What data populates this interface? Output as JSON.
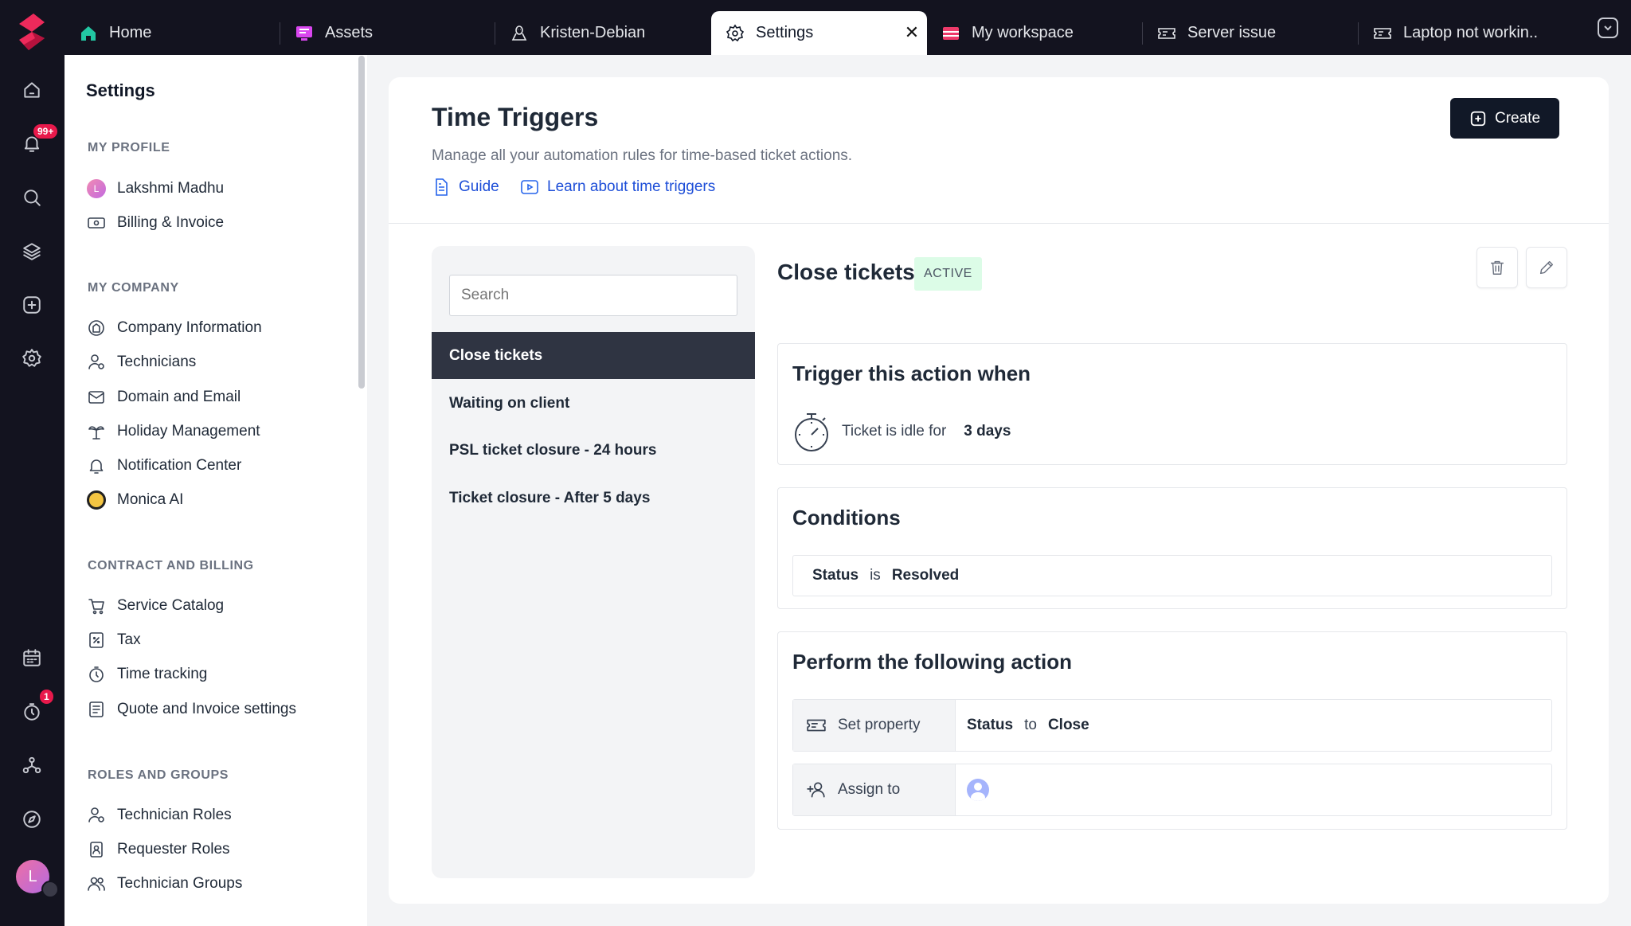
{
  "rail": {
    "notifications_badge": "99+",
    "timer_badge": "1",
    "avatar_initial": "L"
  },
  "tabs": [
    {
      "label": "Home",
      "icon": "home-icon"
    },
    {
      "label": "Assets",
      "icon": "monitor-icon"
    },
    {
      "label": "Kristen-Debian",
      "icon": "linux-icon"
    },
    {
      "label": "Settings",
      "icon": "gear-icon",
      "active": true
    },
    {
      "label": "My workspace",
      "icon": "workspace-icon"
    },
    {
      "label": "Server issue",
      "icon": "ticket-icon"
    },
    {
      "label": "Laptop not workin..",
      "icon": "ticket-icon"
    }
  ],
  "sidebar": {
    "title": "Settings",
    "sections": {
      "my_profile": "MY PROFILE",
      "my_company": "MY COMPANY",
      "contract": "CONTRACT AND BILLING",
      "roles": "ROLES AND GROUPS"
    },
    "items": {
      "profile_name": "Lakshmi Madhu",
      "profile_initial": "L",
      "billing": "Billing & Invoice",
      "company_info": "Company Information",
      "technicians": "Technicians",
      "domain_email": "Domain and Email",
      "holiday": "Holiday Management",
      "notification": "Notification Center",
      "monica": "Monica AI",
      "service_catalog": "Service Catalog",
      "tax": "Tax",
      "time_tracking": "Time tracking",
      "quote_invoice": "Quote and Invoice settings",
      "tech_roles": "Technician Roles",
      "req_roles": "Requester Roles",
      "tech_groups": "Technician Groups"
    }
  },
  "main": {
    "title": "Time Triggers",
    "subtitle": "Manage all your automation rules for time-based ticket actions.",
    "guide_link": "Guide",
    "learn_link": "Learn about time triggers",
    "create_label": "Create"
  },
  "trigger_list": {
    "search_placeholder": "Search",
    "items": [
      "Close tickets",
      "Waiting on client",
      "PSL ticket closure - 24 hours",
      "Ticket closure - After 5 days"
    ]
  },
  "detail": {
    "title": "Close tickets",
    "status": "ACTIVE",
    "trigger": {
      "heading": "Trigger this action when",
      "text": "Ticket is idle for",
      "value": "3 days"
    },
    "conditions": {
      "heading": "Conditions",
      "field": "Status",
      "op": "is",
      "value": "Resolved"
    },
    "actions": {
      "heading": "Perform the following action",
      "set_property_label": "Set property",
      "property": "Status",
      "to": "to",
      "property_value": "Close",
      "assign_label": "Assign to"
    }
  }
}
